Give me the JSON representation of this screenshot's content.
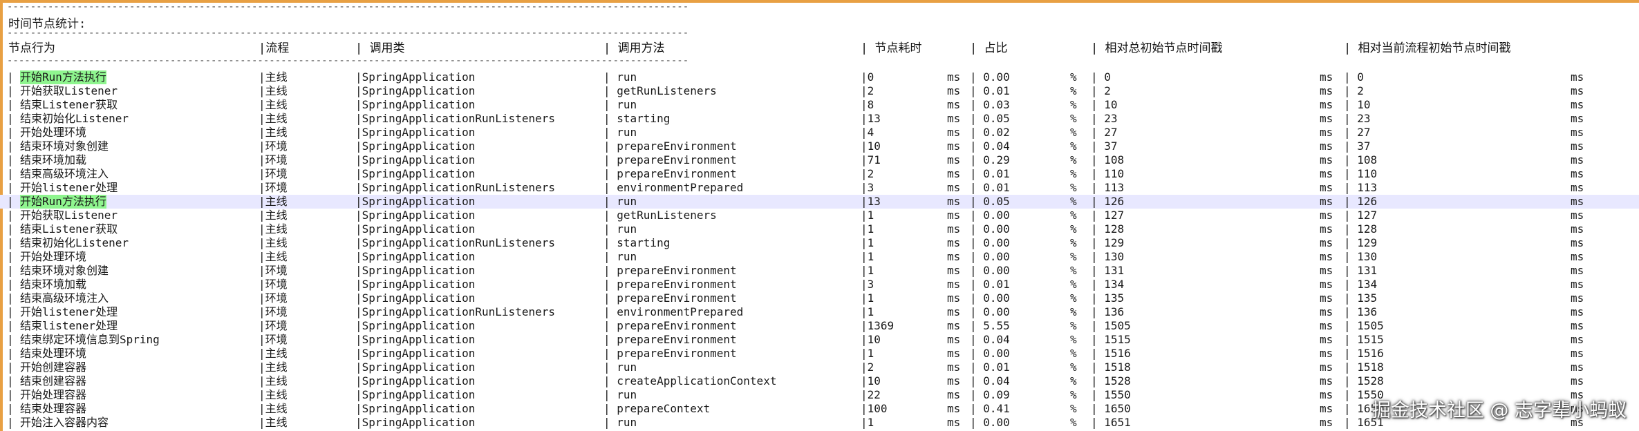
{
  "dash_line": "------------------------------------------------------------------------------------------------------------------------------------------------------------------------------------------------",
  "title": "时间节点统计:",
  "headers": [
    "节点行为",
    "|流程",
    "| 调用类",
    "| 调用方法",
    "| 节点耗时",
    "| 占比",
    "| 相对总初始节点时间戳",
    "| 相对当前流程初始节点时间戳"
  ],
  "unit_ms": "ms",
  "unit_pct": "%",
  "rows": [
    {
      "lead": "| ",
      "action": "开始Run方法执行",
      "flow": "|主线",
      "cls": "|SpringApplication",
      "method": "| run",
      "cost": "|0",
      "pct": "| 0.00",
      "total": "| 0",
      "rel": "| 0",
      "greenAction": true
    },
    {
      "lead": "| ",
      "action": "开始获取Listener",
      "flow": "|主线",
      "cls": "|SpringApplication",
      "method": "| getRunListeners",
      "cost": "|2",
      "pct": "| 0.01",
      "total": "| 2",
      "rel": "| 2"
    },
    {
      "lead": "| ",
      "action": "结束Listener获取",
      "flow": "|主线",
      "cls": "|SpringApplication",
      "method": "| run",
      "cost": "|8",
      "pct": "| 0.03",
      "total": "| 10",
      "rel": "| 10"
    },
    {
      "lead": "| ",
      "action": "结束初始化Listener",
      "flow": "|主线",
      "cls": "|SpringApplicationRunListeners",
      "method": "| starting",
      "cost": "|13",
      "pct": "| 0.05",
      "total": "| 23",
      "rel": "| 23"
    },
    {
      "lead": "| ",
      "action": "开始处理环境",
      "flow": "|主线",
      "cls": "|SpringApplication",
      "method": "| run",
      "cost": "|4",
      "pct": "| 0.02",
      "total": "| 27",
      "rel": "| 27"
    },
    {
      "lead": "| ",
      "action": "结束环境对象创建",
      "flow": "|环境",
      "cls": "|SpringApplication",
      "method": "| prepareEnvironment",
      "cost": "|10",
      "pct": "| 0.04",
      "total": "| 37",
      "rel": "| 37"
    },
    {
      "lead": "| ",
      "action": "结束环境加载",
      "flow": "|环境",
      "cls": "|SpringApplication",
      "method": "| prepareEnvironment",
      "cost": "|71",
      "pct": "| 0.29",
      "total": "| 108",
      "rel": "| 108"
    },
    {
      "lead": "| ",
      "action": "结束高级环境注入",
      "flow": "|环境",
      "cls": "|SpringApplication",
      "method": "| prepareEnvironment",
      "cost": "|2",
      "pct": "| 0.01",
      "total": "| 110",
      "rel": "| 110"
    },
    {
      "lead": "| ",
      "action": "开始listener处理",
      "flow": "|环境",
      "cls": "|SpringApplicationRunListeners",
      "method": "| environmentPrepared",
      "cost": "|3",
      "pct": "| 0.01",
      "total": "| 113",
      "rel": "| 113"
    },
    {
      "lead": "| ",
      "action": "开始Run方法执行",
      "flow": "|主线",
      "cls": "|SpringApplication",
      "method": "| run",
      "cost": "|13",
      "pct": "| 0.05",
      "total": "| 126",
      "rel": "| 126",
      "greenAction": true,
      "highlight": true
    },
    {
      "lead": "| ",
      "action": "开始获取Listener",
      "flow": "|主线",
      "cls": "|SpringApplication",
      "method": "| getRunListeners",
      "cost": "|1",
      "pct": "| 0.00",
      "total": "| 127",
      "rel": "| 127"
    },
    {
      "lead": "| ",
      "action": "结束Listener获取",
      "flow": "|主线",
      "cls": "|SpringApplication",
      "method": "| run",
      "cost": "|1",
      "pct": "| 0.00",
      "total": "| 128",
      "rel": "| 128"
    },
    {
      "lead": "| ",
      "action": "结束初始化Listener",
      "flow": "|主线",
      "cls": "|SpringApplicationRunListeners",
      "method": "| starting",
      "cost": "|1",
      "pct": "| 0.00",
      "total": "| 129",
      "rel": "| 129"
    },
    {
      "lead": "| ",
      "action": "开始处理环境",
      "flow": "|主线",
      "cls": "|SpringApplication",
      "method": "| run",
      "cost": "|1",
      "pct": "| 0.00",
      "total": "| 130",
      "rel": "| 130"
    },
    {
      "lead": "| ",
      "action": "结束环境对象创建",
      "flow": "|环境",
      "cls": "|SpringApplication",
      "method": "| prepareEnvironment",
      "cost": "|1",
      "pct": "| 0.00",
      "total": "| 131",
      "rel": "| 131"
    },
    {
      "lead": "| ",
      "action": "结束环境加载",
      "flow": "|环境",
      "cls": "|SpringApplication",
      "method": "| prepareEnvironment",
      "cost": "|3",
      "pct": "| 0.01",
      "total": "| 134",
      "rel": "| 134"
    },
    {
      "lead": "| ",
      "action": "结束高级环境注入",
      "flow": "|环境",
      "cls": "|SpringApplication",
      "method": "| prepareEnvironment",
      "cost": "|1",
      "pct": "| 0.00",
      "total": "| 135",
      "rel": "| 135"
    },
    {
      "lead": "| ",
      "action": "开始listener处理",
      "flow": "|环境",
      "cls": "|SpringApplicationRunListeners",
      "method": "| environmentPrepared",
      "cost": "|1",
      "pct": "| 0.00",
      "total": "| 136",
      "rel": "| 136"
    },
    {
      "lead": "| ",
      "action": "结束listener处理",
      "flow": "|环境",
      "cls": "|SpringApplication",
      "method": "| prepareEnvironment",
      "cost": "|1369",
      "pct": "| 5.55",
      "total": "| 1505",
      "rel": "| 1505"
    },
    {
      "lead": "| ",
      "action": "结束绑定环境信息到Spring",
      "flow": "|环境",
      "cls": "|SpringApplication",
      "method": "| prepareEnvironment",
      "cost": "|10",
      "pct": "| 0.04",
      "total": "| 1515",
      "rel": "| 1515"
    },
    {
      "lead": "| ",
      "action": "结束处理环境",
      "flow": "|主线",
      "cls": "|SpringApplication",
      "method": "| prepareEnvironment",
      "cost": "|1",
      "pct": "| 0.00",
      "total": "| 1516",
      "rel": "| 1516"
    },
    {
      "lead": "| ",
      "action": "开始创建容器",
      "flow": "|主线",
      "cls": "|SpringApplication",
      "method": "| run",
      "cost": "|2",
      "pct": "| 0.01",
      "total": "| 1518",
      "rel": "| 1518"
    },
    {
      "lead": "| ",
      "action": "结束创建容器",
      "flow": "|主线",
      "cls": "|SpringApplication",
      "method": "| createApplicationContext",
      "cost": "|10",
      "pct": "| 0.04",
      "total": "| 1528",
      "rel": "| 1528"
    },
    {
      "lead": "| ",
      "action": "开始处理容器",
      "flow": "|主线",
      "cls": "|SpringApplication",
      "method": "| run",
      "cost": "|22",
      "pct": "| 0.09",
      "total": "| 1550",
      "rel": "| 1550"
    },
    {
      "lead": "| ",
      "action": "结束处理容器",
      "flow": "|主线",
      "cls": "|SpringApplication",
      "method": "| prepareContext",
      "cost": "|100",
      "pct": "| 0.41",
      "total": "| 1650",
      "rel": "| 1650"
    },
    {
      "lead": "| ",
      "action": "开始注入容器内容",
      "flow": "|主线",
      "cls": "|SpringApplication",
      "method": "| run",
      "cost": "|1",
      "pct": "| 0.00",
      "total": "| 1651",
      "rel": "| 1651"
    }
  ],
  "watermark": "掘金技术社区 @ 志字辈小蚂蚁"
}
